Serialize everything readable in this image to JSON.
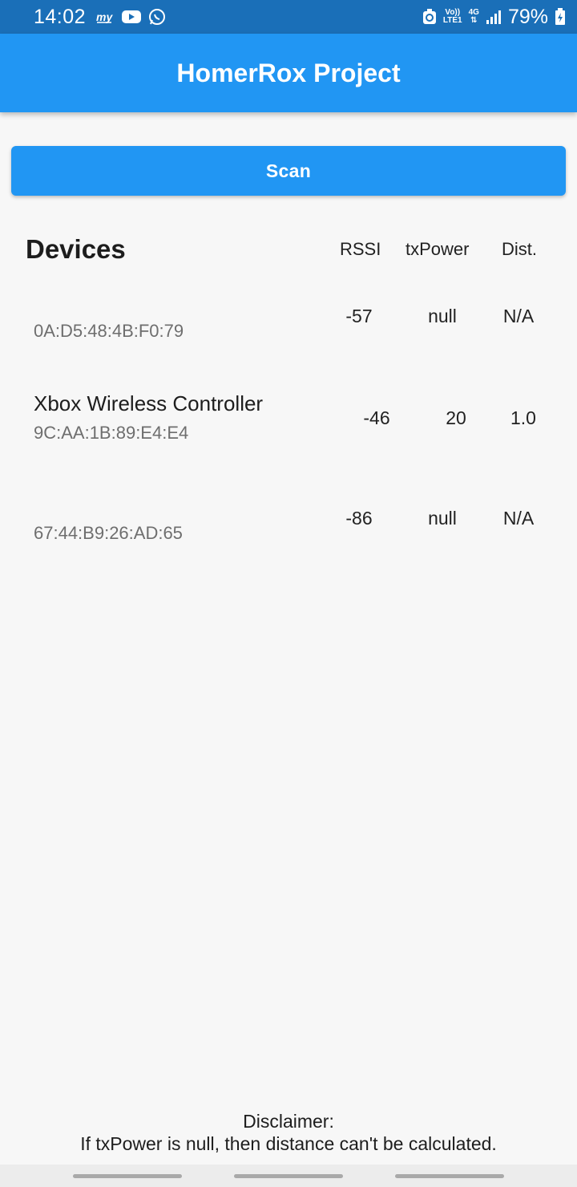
{
  "status_bar": {
    "time": "14:02",
    "icons_left": [
      "paytm-icon",
      "youtube-icon",
      "whatsapp-icon"
    ],
    "volte_top": "Vo))",
    "volte_bottom": "LTE1",
    "network_label": "4G",
    "battery_percent": "79%"
  },
  "app_bar": {
    "title": "HomerRox Project"
  },
  "scan_button": {
    "label": "Scan"
  },
  "devices_header": {
    "title": "Devices",
    "col_rssi": "RSSI",
    "col_txpower": "txPower",
    "col_dist": "Dist."
  },
  "devices": [
    {
      "name": "",
      "mac": "0A:D5:48:4B:F0:79",
      "rssi": "-57",
      "txpower": "null",
      "dist": "N/A"
    },
    {
      "name": "Xbox Wireless Controller",
      "mac": "9C:AA:1B:89:E4:E4",
      "rssi": "-46",
      "txpower": "20",
      "dist": "1.0"
    },
    {
      "name": "",
      "mac": "67:44:B9:26:AD:65",
      "rssi": "-86",
      "txpower": "null",
      "dist": "N/A"
    }
  ],
  "disclaimer": {
    "title": "Disclaimer:",
    "text": "If txPower is null, then distance can't be calculated."
  },
  "colors": {
    "status_bar": "#1a6fb8",
    "primary": "#2196f3",
    "background": "#f7f7f7"
  }
}
